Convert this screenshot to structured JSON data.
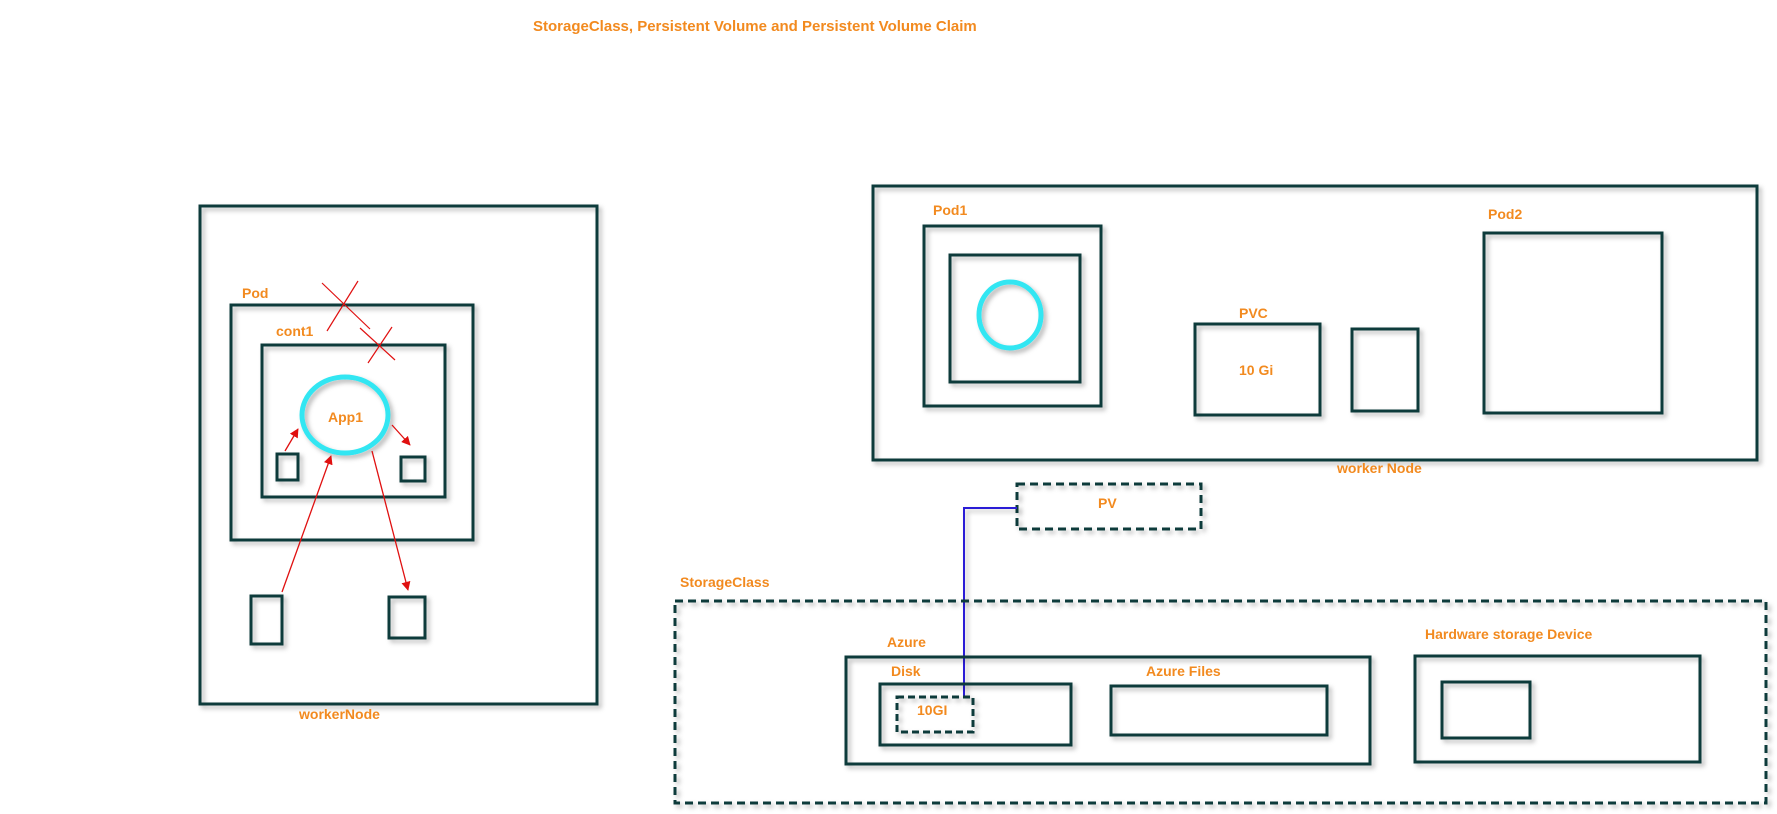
{
  "title": "StorageClass, Persistent Volume and Persistent Volume Claim",
  "colors": {
    "box_stroke": "#0E3B3B",
    "label": "#F28A1F",
    "divider": "#1A12E6",
    "connector": "#2A1FD6",
    "app_ring": "#33E6F2",
    "red_marks": "#E01010"
  },
  "left_panel": {
    "worker_node_label": "workerNode",
    "pod_label": "Pod",
    "container_label": "cont1",
    "app_label": "App1"
  },
  "right_panel": {
    "pod1_label": "Pod1",
    "pod2_label": "Pod2",
    "pvc_label": "PVC",
    "pvc_size": "10 Gi",
    "worker_node_label": "worker Node",
    "pv_label": "PV",
    "storage_class_label": "StorageClass",
    "azure_label": "Azure",
    "disk_label": "Disk",
    "disk_volume_label": "10GI",
    "azure_files_label": "Azure Files",
    "hardware_label": "Hardware storage Device"
  }
}
